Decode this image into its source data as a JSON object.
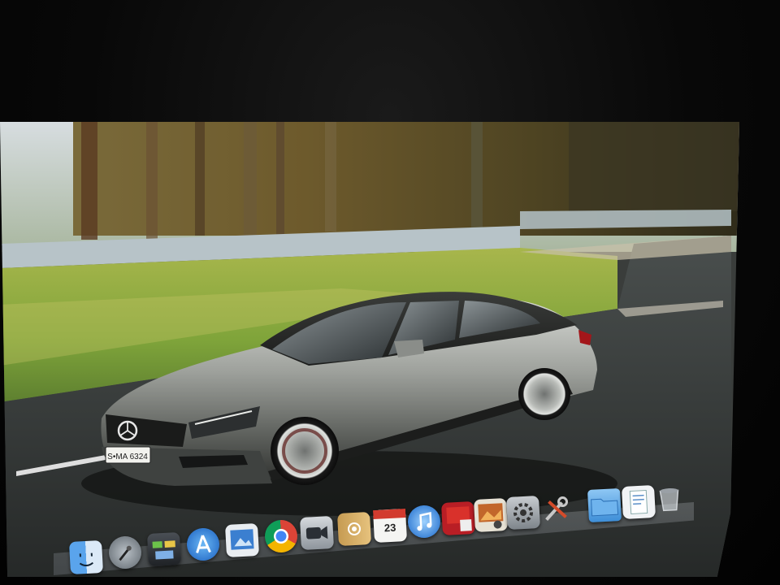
{
  "desktop": {
    "wallpaper": {
      "plate_text": "S•MA 6324"
    }
  },
  "dock": {
    "items": [
      {
        "name": "finder",
        "icon": "finder-icon"
      },
      {
        "name": "launchpad",
        "icon": "rocket-icon"
      },
      {
        "name": "mission-control",
        "icon": "mission-control-icon"
      },
      {
        "name": "app-store",
        "icon": "app-store-icon"
      },
      {
        "name": "preview",
        "icon": "preview-icon"
      },
      {
        "name": "chrome",
        "icon": "chrome-icon"
      },
      {
        "name": "facetime",
        "icon": "camera-icon"
      },
      {
        "name": "contacts",
        "icon": "address-book-icon"
      },
      {
        "name": "calendar",
        "icon": "calendar-icon",
        "day": "23"
      },
      {
        "name": "itunes",
        "icon": "music-note-icon"
      },
      {
        "name": "photo-booth",
        "icon": "photo-booth-icon"
      },
      {
        "name": "iphoto",
        "icon": "photo-icon"
      },
      {
        "name": "system-preferences",
        "icon": "gear-icon"
      },
      {
        "name": "utilities",
        "icon": "tools-icon"
      },
      {
        "name": "applications-folder",
        "icon": "folder-icon"
      },
      {
        "name": "document-stack",
        "icon": "document-icon"
      },
      {
        "name": "trash",
        "icon": "trash-icon"
      }
    ]
  },
  "colors": {
    "dock_blue": "#2f7fd6",
    "car_silver": "#a7aaa6",
    "grass": "#8fae45"
  }
}
